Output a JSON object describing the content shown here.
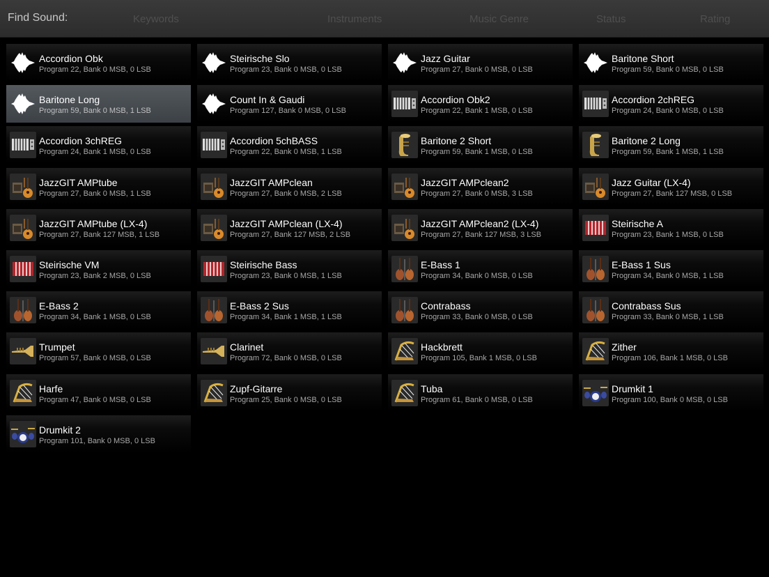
{
  "header": {
    "find_label": "Find Sound:",
    "filters": [
      "Keywords",
      "Instruments",
      "Music Genre",
      "Status",
      "Rating"
    ]
  },
  "sounds": [
    {
      "name": "Accordion Obk",
      "detail": "Program 22, Bank 0 MSB, 0 LSB",
      "icon": "waveform-icon"
    },
    {
      "name": "Steirische Slo",
      "detail": "Program 23, Bank 0 MSB, 0 LSB",
      "icon": "waveform-icon"
    },
    {
      "name": "Jazz Guitar",
      "detail": "Program 27, Bank 0 MSB, 0 LSB",
      "icon": "waveform-icon"
    },
    {
      "name": "Baritone Short",
      "detail": "Program 59, Bank 0 MSB, 0 LSB",
      "icon": "waveform-icon"
    },
    {
      "name": "Baritone Long",
      "detail": "Program 59, Bank 0 MSB, 1 LSB",
      "icon": "waveform-icon",
      "selected": true
    },
    {
      "name": "Count In & Gaudi",
      "detail": "Program 127, Bank 0 MSB, 0 LSB",
      "icon": "waveform-icon"
    },
    {
      "name": "Accordion Obk2",
      "detail": "Program 22, Bank 1 MSB, 0 LSB",
      "icon": "accordion-icon"
    },
    {
      "name": "Accordion 2chREG",
      "detail": "Program 24, Bank 0 MSB, 0 LSB",
      "icon": "accordion-icon"
    },
    {
      "name": "Accordion 3chREG",
      "detail": "Program 24, Bank 1 MSB, 0 LSB",
      "icon": "accordion-icon"
    },
    {
      "name": "Accordion 5chBASS",
      "detail": "Program 22, Bank 0 MSB, 1 LSB",
      "icon": "accordion-icon"
    },
    {
      "name": "Baritone 2 Short",
      "detail": "Program 59, Bank 1 MSB, 0 LSB",
      "icon": "tuba-icon"
    },
    {
      "name": "Baritone 2 Long",
      "detail": "Program 59, Bank 1 MSB, 1 LSB",
      "icon": "tuba-icon"
    },
    {
      "name": "JazzGIT AMPtube",
      "detail": "Program 27, Bank 0 MSB, 1 LSB",
      "icon": "guitar-amp-icon"
    },
    {
      "name": "JazzGIT AMPclean",
      "detail": "Program 27, Bank 0 MSB, 2 LSB",
      "icon": "guitar-amp-icon"
    },
    {
      "name": "JazzGIT AMPclean2",
      "detail": "Program 27, Bank 0 MSB, 3 LSB",
      "icon": "guitar-amp-icon"
    },
    {
      "name": "Jazz Guitar (LX-4)",
      "detail": "Program 27, Bank 127 MSB, 0 LSB",
      "icon": "guitar-amp-icon"
    },
    {
      "name": "JazzGIT AMPtube (LX-4)",
      "detail": "Program 27, Bank 127 MSB, 1 LSB",
      "icon": "guitar-amp-icon"
    },
    {
      "name": "JazzGIT AMPclean (LX-4)",
      "detail": "Program 27, Bank 127 MSB, 2 LSB",
      "icon": "guitar-amp-icon"
    },
    {
      "name": "JazzGIT AMPclean2 (LX-4)",
      "detail": "Program 27, Bank 127 MSB, 3 LSB",
      "icon": "guitar-amp-icon"
    },
    {
      "name": "Steirische A",
      "detail": "Program 23, Bank 1 MSB, 0 LSB",
      "icon": "red-accordion-icon"
    },
    {
      "name": "Steirische VM",
      "detail": "Program 23, Bank 2 MSB, 0 LSB",
      "icon": "red-accordion-icon"
    },
    {
      "name": "Steirische Bass",
      "detail": "Program 23, Bank 0 MSB, 1 LSB",
      "icon": "red-accordion-icon"
    },
    {
      "name": "E-Bass 1",
      "detail": "Program 34, Bank 0 MSB, 0 LSB",
      "icon": "bass-icon"
    },
    {
      "name": "E-Bass 1 Sus",
      "detail": "Program 34, Bank 0 MSB, 1 LSB",
      "icon": "bass-icon"
    },
    {
      "name": "E-Bass 2",
      "detail": "Program 34, Bank 1 MSB, 0 LSB",
      "icon": "bass-icon"
    },
    {
      "name": "E-Bass 2 Sus",
      "detail": "Program 34, Bank 1 MSB, 1 LSB",
      "icon": "bass-icon"
    },
    {
      "name": "Contrabass",
      "detail": "Program 33, Bank 0 MSB, 0 LSB",
      "icon": "bass-icon"
    },
    {
      "name": "Contrabass Sus",
      "detail": "Program 33, Bank 0 MSB, 1 LSB",
      "icon": "bass-icon"
    },
    {
      "name": "Trumpet",
      "detail": "Program 57, Bank 0 MSB, 0 LSB",
      "icon": "trumpet-icon"
    },
    {
      "name": "Clarinet",
      "detail": "Program 72, Bank 0 MSB, 0 LSB",
      "icon": "trumpet-icon"
    },
    {
      "name": "Hackbrett",
      "detail": "Program 105, Bank 1 MSB, 0 LSB",
      "icon": "harp-icon"
    },
    {
      "name": "Zither",
      "detail": "Program 106, Bank 1 MSB, 0 LSB",
      "icon": "harp-icon"
    },
    {
      "name": "Harfe",
      "detail": "Program 47, Bank 0 MSB, 0 LSB",
      "icon": "harp-icon"
    },
    {
      "name": "Zupf-Gitarre",
      "detail": "Program 25, Bank 0 MSB, 0 LSB",
      "icon": "harp-icon"
    },
    {
      "name": "Tuba",
      "detail": "Program 61, Bank 0 MSB, 0 LSB",
      "icon": "harp-icon"
    },
    {
      "name": "Drumkit 1",
      "detail": "Program 100, Bank 0 MSB, 0 LSB",
      "icon": "drumkit-icon"
    },
    {
      "name": "Drumkit 2",
      "detail": "Program 101, Bank 0 MSB, 0 LSB",
      "icon": "drumkit-icon"
    }
  ]
}
